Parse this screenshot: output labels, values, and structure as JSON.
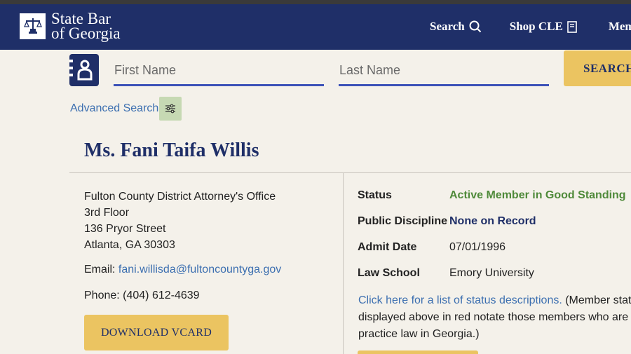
{
  "header": {
    "logo_line1": "State Bar",
    "logo_line2": "of Georgia",
    "nav": {
      "search_label": "Search",
      "shop_label": "Shop CLE",
      "member_label": "Memb"
    }
  },
  "search_form": {
    "first_name_placeholder": "First Name",
    "last_name_placeholder": "Last Name",
    "first_name_value": "",
    "last_name_value": "",
    "search_button_label": "SEARCH",
    "advanced_search_label": "Advanced Search"
  },
  "member": {
    "name": "Ms. Fani Taifa Willis",
    "address": [
      "Fulton County District Attorney's Office",
      "3rd Floor",
      "136 Pryor Street",
      "Atlanta, GA 30303"
    ],
    "email_label": "Email:",
    "email": "fani.willisda@fultoncountyga.gov",
    "phone": "Phone: (404) 612-4639",
    "vcard_button_label": "DOWNLOAD VCARD",
    "details": {
      "status_label": "Status",
      "status_value": "Active Member in Good Standing",
      "discipline_label": "Public Discipline",
      "discipline_value": "None on Record",
      "admit_label": "Admit Date",
      "admit_value": "07/01/1996",
      "school_label": "Law School",
      "school_value": "Emory University"
    },
    "status_note_link": "Click here for a list of status descriptions.",
    "status_note_line1": " (Member statu",
    "status_note_line2": "displayed above in red notate those members who are n",
    "status_note_line3": "practice law in Georgia.)"
  },
  "colors": {
    "header_bg": "#1f2f68",
    "accent_gold": "#ebc461",
    "link_blue": "#3c6fb0",
    "status_green": "#4f8a3a",
    "page_bg": "#f4f1ea"
  },
  "icons": {
    "logo": "scales-of-justice-icon",
    "search": "magnifier-icon",
    "shop": "book-icon",
    "contact": "contact-book-icon",
    "advanced": "sliders-icon",
    "help": "question-circle-icon"
  }
}
